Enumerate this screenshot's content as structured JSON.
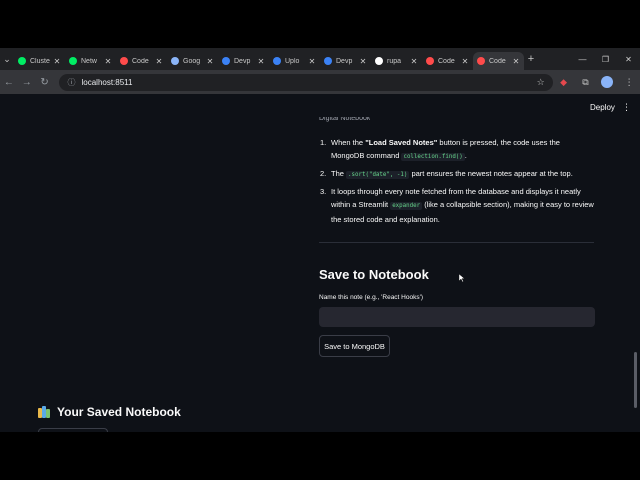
{
  "browser": {
    "tabs": [
      {
        "label": "Cluste",
        "icon": "mongodb-leaf-icon",
        "color": "#00ed64"
      },
      {
        "label": "Netw",
        "icon": "mongodb-leaf-icon",
        "color": "#00ed64"
      },
      {
        "label": "Code",
        "icon": "streamlit-icon",
        "color": "#ff4b4b"
      },
      {
        "label": "Goog",
        "icon": "google-ai-icon",
        "color": "#8ab4f8"
      },
      {
        "label": "Devp",
        "icon": "d-icon",
        "color": "#3b82f6"
      },
      {
        "label": "Uplo",
        "icon": "d-icon",
        "color": "#3b82f6"
      },
      {
        "label": "Devp",
        "icon": "d-icon",
        "color": "#3b82f6"
      },
      {
        "label": "rupa",
        "icon": "github-icon",
        "color": "#ffffff"
      },
      {
        "label": "Code",
        "icon": "streamlit-icon",
        "color": "#ff4b4b"
      },
      {
        "label": "Code",
        "icon": "streamlit-icon",
        "color": "#ff4b4b",
        "active": true
      }
    ],
    "url": "localhost:8511"
  },
  "app": {
    "deploy_label": "Deploy",
    "clipped_heading": "Digital Notebook",
    "steps": [
      {
        "num": "1.",
        "pre": "When the ",
        "bold": "\"Load Saved Notes\"",
        "mid": " button is pressed, the code uses the MongoDB command ",
        "code": "collection.find()",
        "post": "."
      },
      {
        "num": "2.",
        "pre": "The ",
        "code": ".sort(\"date\", -1)",
        "post": " part ensures the newest notes appear at the top."
      },
      {
        "num": "3.",
        "pre": "It loops through every note fetched from the database and displays it neatly within a Streamlit ",
        "code": "expander",
        "post": " (like a collapsible section), making it easy to review the stored code and explanation."
      }
    ],
    "save_section": {
      "title": "Save to Notebook",
      "field_label": "Name this note (e.g., 'React Hooks')",
      "field_value": "",
      "button_label": "Save to MongoDB"
    },
    "saved_section": {
      "title": "Your Saved Notebook",
      "icon": "books-icon"
    }
  }
}
